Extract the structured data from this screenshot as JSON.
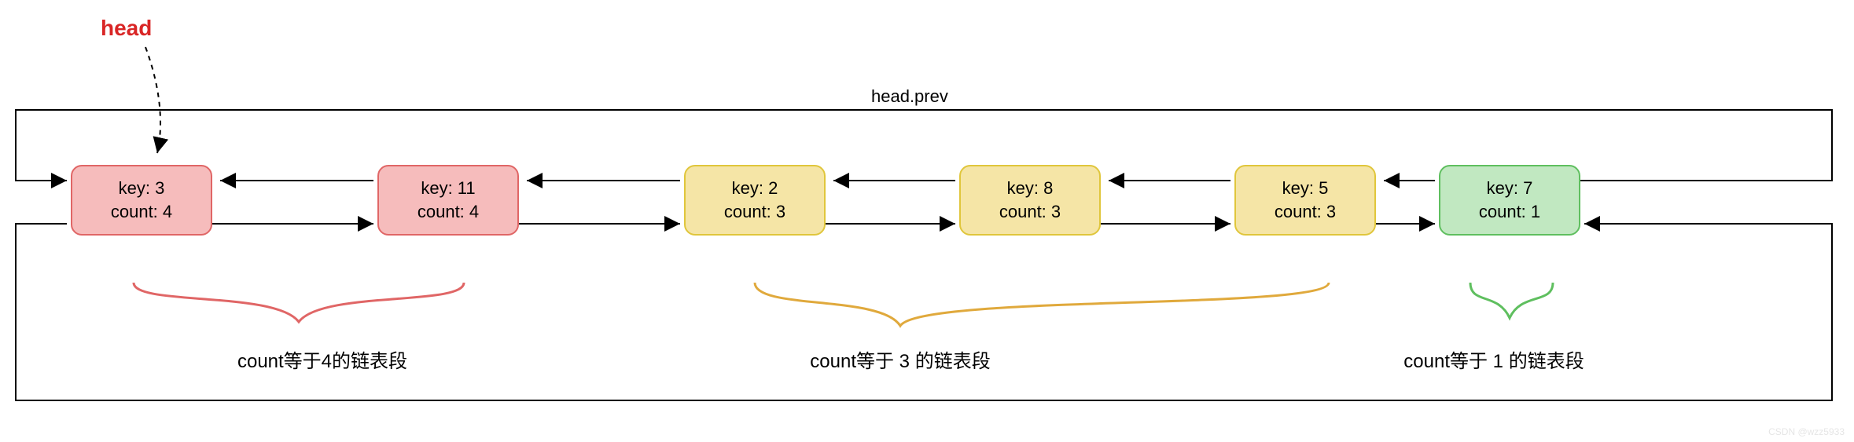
{
  "head_label": "head",
  "top_label": "head.prev",
  "nodes": [
    {
      "key_label": "key: 3",
      "count_label": "count: 4",
      "color": "red"
    },
    {
      "key_label": "key: 11",
      "count_label": "count: 4",
      "color": "red"
    },
    {
      "key_label": "key: 2",
      "count_label": "count: 3",
      "color": "yellow"
    },
    {
      "key_label": "key: 8",
      "count_label": "count: 3",
      "color": "yellow"
    },
    {
      "key_label": "key: 5",
      "count_label": "count: 3",
      "color": "yellow"
    },
    {
      "key_label": "key: 7",
      "count_label": "count: 1",
      "color": "green"
    }
  ],
  "segments": [
    {
      "label": "count等于4的链表段",
      "color": "#e06666"
    },
    {
      "label": "count等于 3 的链表段",
      "color": "#e0a93c"
    },
    {
      "label": "count等于 1 的链表段",
      "color": "#5fbf5f"
    }
  ],
  "watermark": "CSDN @wzz5933"
}
